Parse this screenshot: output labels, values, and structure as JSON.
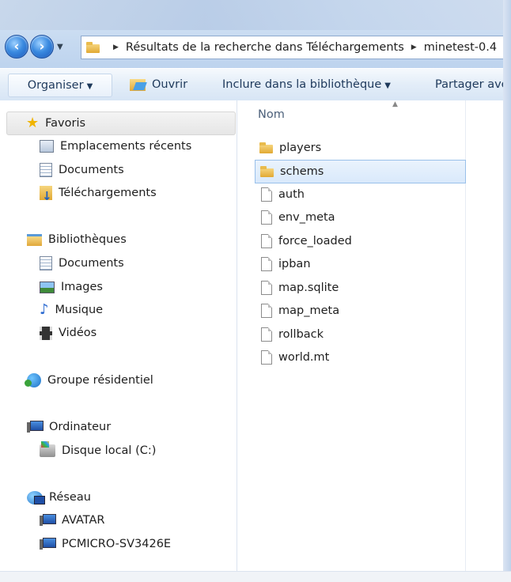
{
  "address": {
    "crumbs": [
      "Résultats de la recherche dans Téléchargements",
      "minetest-0.4"
    ]
  },
  "toolbar": {
    "organize": "Organiser",
    "open": "Ouvrir",
    "include": "Inclure dans la bibliothèque",
    "share": "Partager avec"
  },
  "navpane": {
    "favorites": {
      "label": "Favoris",
      "items": [
        "Emplacements récents",
        "Documents",
        "Téléchargements"
      ]
    },
    "libraries": {
      "label": "Bibliothèques",
      "items": [
        "Documents",
        "Images",
        "Musique",
        "Vidéos"
      ]
    },
    "homegroup": "Groupe résidentiel",
    "computer": {
      "label": "Ordinateur",
      "items": [
        "Disque local (C:)"
      ]
    },
    "network": {
      "label": "Réseau",
      "items": [
        "AVATAR",
        "PCMICRO-SV3426E"
      ]
    }
  },
  "content": {
    "column_name": "Nom",
    "files": [
      {
        "name": "players",
        "type": "folder"
      },
      {
        "name": "schems",
        "type": "folder",
        "selected": true
      },
      {
        "name": "auth",
        "type": "file"
      },
      {
        "name": "env_meta",
        "type": "file"
      },
      {
        "name": "force_loaded",
        "type": "file"
      },
      {
        "name": "ipban",
        "type": "file"
      },
      {
        "name": "map.sqlite",
        "type": "file"
      },
      {
        "name": "map_meta",
        "type": "file"
      },
      {
        "name": "rollback",
        "type": "file"
      },
      {
        "name": "world.mt",
        "type": "file"
      }
    ]
  },
  "colors": {
    "selection": "#d9e9fb",
    "selection_border": "#99c0ea",
    "toolbar_text": "#1e395b"
  }
}
